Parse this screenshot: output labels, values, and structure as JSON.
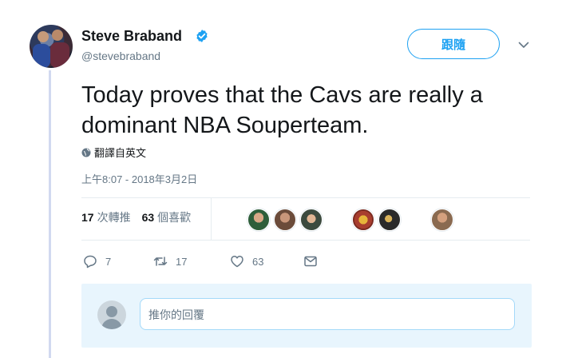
{
  "tweet": {
    "author_name": "Steve Braband",
    "author_handle": "@stevebraband",
    "follow_label": "跟隨",
    "text": "Today proves that the Cavs are really a dominant NBA Souperteam.",
    "translate_label": "翻譯自英文",
    "timestamp": "上午8:07 - 2018年3月2日"
  },
  "stats": {
    "retweets_count": "17",
    "retweets_label": "次轉推",
    "likes_count": "63",
    "likes_label": "個喜歡"
  },
  "actions": {
    "reply_count": "7",
    "retweet_count": "17",
    "like_count": "63"
  },
  "reply": {
    "placeholder": "推你的回覆"
  },
  "colors": {
    "accent": "#1da1f2",
    "text": "#14171a",
    "secondary": "#657786",
    "reply_bg": "#e8f5fd"
  },
  "icons": [
    "verified-badge-icon",
    "chevron-down-icon",
    "globe-icon",
    "reply-icon",
    "retweet-icon",
    "like-icon",
    "message-icon"
  ]
}
